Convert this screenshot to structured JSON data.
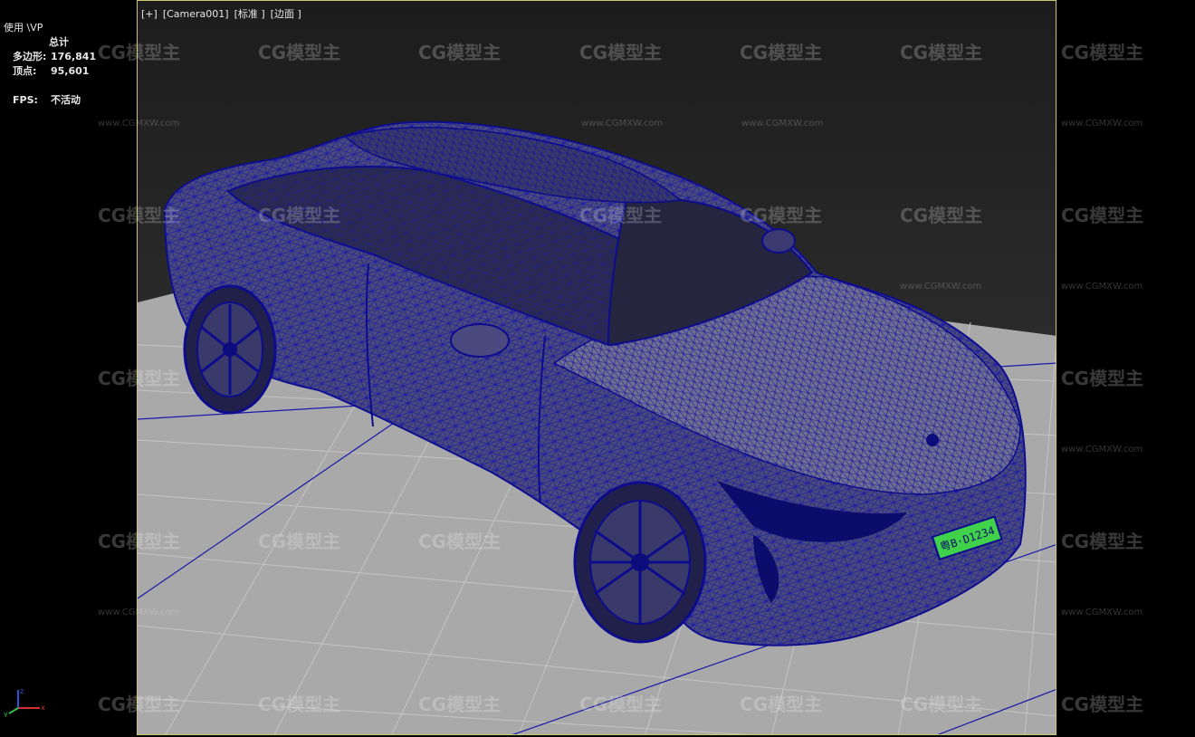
{
  "viewport": {
    "label_parts": [
      "[+]",
      "[Camera001]",
      "[标准 ]",
      "[边面 ]"
    ],
    "driver_label": "使用 \\VP"
  },
  "stats": {
    "header": "总计",
    "polygons_label": "多边形:",
    "polygons_value": "176,841",
    "vertices_label": "顶点:",
    "vertices_value": "95,601",
    "fps_label": "FPS:",
    "fps_value": "不活动"
  },
  "watermark": {
    "brand": "CG模型主",
    "url": "www.CGMXW.com"
  },
  "license_plate": "粤B·D1234",
  "axis_labels": {
    "x": "x",
    "y": "y",
    "z": "z"
  },
  "colors": {
    "viewport_bg_top": "#1e1e1e",
    "viewport_bg_bottom": "#3a3a3a",
    "floor": "#a9a9a9",
    "grid": "#c2c2c2",
    "grid_axis": "#1a1aa8",
    "wireframe": "#1010a0",
    "plate": "#3fd24a",
    "viewport_border": "#c8c86a"
  }
}
